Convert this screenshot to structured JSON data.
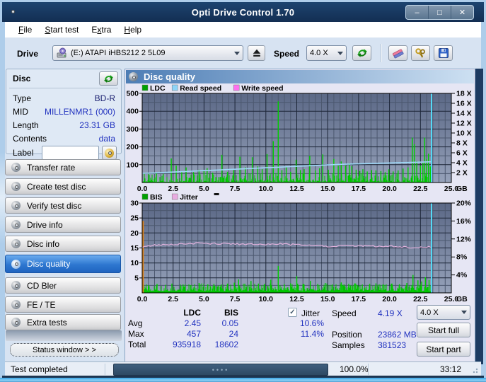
{
  "window": {
    "title": "Opti Drive Control 1.70",
    "controls": {
      "minimize": "–",
      "maximize": "□",
      "close": "✕"
    }
  },
  "menu": {
    "items": [
      {
        "pre": "",
        "u": "F",
        "rest": "ile"
      },
      {
        "pre": "",
        "u": "S",
        "rest": "tart test"
      },
      {
        "pre": "E",
        "u": "x",
        "rest": "tra"
      },
      {
        "pre": "",
        "u": "H",
        "rest": "elp"
      }
    ]
  },
  "drive_bar": {
    "drive_label": "Drive",
    "drive_value": "(E:)   ATAPI iHBS212   2 5L09",
    "speed_label": "Speed",
    "speed_value": "4.0 X"
  },
  "sidebar": {
    "disc_panel": {
      "title": "Disc",
      "rows": [
        {
          "label": "Type",
          "value": "BD-R"
        },
        {
          "label": "MID",
          "value": "MILLENMR1 (000)"
        },
        {
          "label": "Length",
          "value": "23.31 GB"
        },
        {
          "label": "Contents",
          "value": "data"
        }
      ],
      "label_row": {
        "label": "Label",
        "value": ""
      }
    },
    "buttons": [
      "Transfer rate",
      "Create test disc",
      "Verify test disc",
      "Drive info",
      "Disc info",
      "Disc quality",
      "CD Bler",
      "FE / TE",
      "Extra tests"
    ],
    "selected": "Disc quality",
    "status_window_button": "Status window > >"
  },
  "main": {
    "header": "Disc quality"
  },
  "chart_data": [
    {
      "name": "disc-quality-main-chart",
      "type": "bar",
      "legend": [
        "LDC",
        "Read speed",
        "Write speed"
      ],
      "legend_colors": [
        "#00a000",
        "#8ed4f8",
        "#ff70f0"
      ],
      "xlabel": "GB",
      "x_ticks": [
        "0.0",
        "2.5",
        "5.0",
        "7.5",
        "10.0",
        "12.5",
        "15.0",
        "17.5",
        "20.0",
        "22.5",
        "25.0"
      ],
      "xlim": [
        0,
        25
      ],
      "ylim_left": [
        0,
        500
      ],
      "y_ticks_left": [
        "500",
        "400",
        "300",
        "200",
        "100"
      ],
      "y_ticks_right": [
        "18 X",
        "16 X",
        "14 X",
        "12 X",
        "10 X",
        "8 X",
        "6 X",
        "4 X",
        "2 X"
      ],
      "data_end_gb": 23.35,
      "end_marker_gb": 23.4,
      "spikes": [
        [
          1.15,
          55
        ],
        [
          1.7,
          48
        ],
        [
          2.35,
          135
        ],
        [
          2.75,
          95
        ],
        [
          3.2,
          60
        ],
        [
          3.55,
          85
        ],
        [
          4.15,
          58
        ],
        [
          4.6,
          72
        ],
        [
          5.0,
          65
        ],
        [
          5.25,
          80
        ],
        [
          5.7,
          55
        ],
        [
          6.45,
          155
        ],
        [
          6.9,
          60
        ],
        [
          7.4,
          70
        ],
        [
          7.9,
          145
        ],
        [
          8.35,
          85
        ],
        [
          8.9,
          142
        ],
        [
          9.35,
          90
        ],
        [
          9.7,
          75
        ],
        [
          10.1,
          160
        ],
        [
          10.6,
          232
        ],
        [
          11.0,
          455
        ],
        [
          11.3,
          70
        ],
        [
          11.65,
          85
        ],
        [
          12.0,
          60
        ],
        [
          12.45,
          128
        ],
        [
          12.8,
          70
        ],
        [
          13.1,
          75
        ],
        [
          13.55,
          150
        ],
        [
          14.0,
          68
        ],
        [
          14.35,
          80
        ],
        [
          14.6,
          158
        ],
        [
          15.05,
          72
        ],
        [
          15.5,
          132
        ],
        [
          15.85,
          95
        ],
        [
          16.1,
          118
        ],
        [
          16.45,
          95
        ],
        [
          16.75,
          108
        ],
        [
          16.95,
          92
        ],
        [
          17.3,
          72
        ],
        [
          17.6,
          65
        ],
        [
          17.85,
          75
        ],
        [
          18.2,
          62
        ],
        [
          18.55,
          70
        ],
        [
          18.9,
          68
        ],
        [
          19.3,
          64
        ],
        [
          19.65,
          58
        ],
        [
          19.95,
          74
        ],
        [
          20.3,
          62
        ],
        [
          20.7,
          68
        ],
        [
          21.1,
          78
        ],
        [
          21.5,
          85
        ],
        [
          21.85,
          252
        ],
        [
          22.0,
          215
        ],
        [
          22.2,
          120
        ],
        [
          22.5,
          95
        ],
        [
          22.7,
          110
        ],
        [
          22.85,
          252
        ],
        [
          23.0,
          130
        ],
        [
          23.15,
          162
        ],
        [
          23.3,
          90
        ]
      ],
      "read_speed_x": [
        [
          0,
          1.85
        ],
        [
          1,
          1.95
        ],
        [
          2,
          2.06
        ],
        [
          3,
          2.17
        ],
        [
          4,
          2.29
        ],
        [
          5,
          2.4
        ],
        [
          6,
          2.52
        ],
        [
          7,
          2.63
        ],
        [
          8,
          2.75
        ],
        [
          9,
          2.86
        ],
        [
          10,
          2.98
        ],
        [
          11,
          3.09
        ],
        [
          12,
          3.21
        ],
        [
          13,
          3.33
        ],
        [
          14,
          3.44
        ],
        [
          15,
          3.56
        ],
        [
          16,
          3.67
        ],
        [
          17,
          3.74
        ],
        [
          18,
          3.81
        ],
        [
          19,
          3.88
        ],
        [
          20,
          3.95
        ],
        [
          21,
          4.02
        ],
        [
          22,
          4.09
        ],
        [
          23,
          4.15
        ],
        [
          23.4,
          4.19
        ]
      ]
    },
    {
      "name": "bis-jitter-chart",
      "type": "bar",
      "legend": [
        "BIS",
        "Jitter"
      ],
      "legend_colors": [
        "#00a000",
        "#e8ace0"
      ],
      "legend_artifact": true,
      "xlabel": "GB",
      "x_ticks": [
        "0.0",
        "2.5",
        "5.0",
        "7.5",
        "10.0",
        "12.5",
        "15.0",
        "17.5",
        "20.0",
        "22.5",
        "25.0"
      ],
      "xlim": [
        0,
        25
      ],
      "ylim_left": [
        0,
        30
      ],
      "y_ticks_left": [
        "30",
        "25",
        "20",
        "15",
        "10",
        "5"
      ],
      "y_ticks_right": [
        "20%",
        "16%",
        "12%",
        "8%",
        "4%"
      ],
      "data_end_gb": 23.35,
      "end_marker_gb": 23.4,
      "start_marker": {
        "gb": 0.07,
        "value": 24,
        "color": "#e08418"
      },
      "spikes": [
        [
          0.5,
          2.6
        ],
        [
          1.2,
          3.0
        ],
        [
          1.9,
          2.7
        ],
        [
          2.4,
          3.1
        ],
        [
          3.3,
          2.8
        ],
        [
          3.9,
          2.6
        ],
        [
          4.6,
          3.3
        ],
        [
          5.3,
          2.8
        ],
        [
          5.8,
          3.0
        ],
        [
          6.4,
          2.7
        ],
        [
          6.9,
          3.1
        ],
        [
          7.45,
          3.4
        ],
        [
          7.8,
          4.5
        ],
        [
          8.3,
          3.0
        ],
        [
          8.8,
          4.0
        ],
        [
          9.4,
          3.1
        ],
        [
          9.9,
          2.9
        ],
        [
          10.4,
          4.4
        ],
        [
          11.0,
          9.0
        ],
        [
          11.5,
          2.9
        ],
        [
          12.0,
          3.2
        ],
        [
          12.5,
          5.6
        ],
        [
          13.0,
          2.9
        ],
        [
          13.6,
          4.0
        ],
        [
          14.2,
          3.0
        ],
        [
          14.8,
          3.3
        ],
        [
          15.4,
          2.8
        ],
        [
          16.1,
          3.5
        ],
        [
          16.7,
          3.0
        ],
        [
          17.2,
          3.2
        ],
        [
          17.8,
          2.8
        ],
        [
          18.4,
          3.0
        ],
        [
          18.9,
          3.2
        ],
        [
          19.5,
          2.8
        ],
        [
          20.2,
          3.1
        ],
        [
          20.8,
          2.9
        ],
        [
          21.4,
          3.3
        ],
        [
          21.9,
          6.0
        ],
        [
          22.3,
          4.2
        ],
        [
          22.6,
          3.8
        ],
        [
          22.9,
          5.2
        ],
        [
          23.2,
          4.3
        ]
      ],
      "jitter_line_pct": [
        [
          0,
          10.1
        ],
        [
          0.5,
          10.4
        ],
        [
          1,
          10.6
        ],
        [
          2,
          10.75
        ],
        [
          3,
          10.85
        ],
        [
          4,
          11.0
        ],
        [
          5,
          11.05
        ],
        [
          6,
          10.95
        ],
        [
          7,
          10.95
        ],
        [
          8,
          10.85
        ],
        [
          9,
          10.85
        ],
        [
          10,
          10.8
        ],
        [
          11,
          10.95
        ],
        [
          12,
          10.75
        ],
        [
          13,
          10.75
        ],
        [
          14,
          10.65
        ],
        [
          15,
          10.35
        ],
        [
          16,
          10.45
        ],
        [
          17,
          10.55
        ],
        [
          18,
          10.45
        ],
        [
          19,
          10.35
        ],
        [
          20,
          10.45
        ],
        [
          21,
          10.2
        ],
        [
          22,
          10.1
        ],
        [
          23,
          10.2
        ],
        [
          23.4,
          10.2
        ]
      ]
    }
  ],
  "results": {
    "col_headers": [
      "LDC",
      "BIS"
    ],
    "rows": [
      {
        "label": "Avg",
        "ldc": "2.45",
        "bis": "0.05",
        "jitter_pct": "10.6%"
      },
      {
        "label": "Max",
        "ldc": "457",
        "bis": "24",
        "jitter_pct": "11.4%"
      },
      {
        "label": "Total",
        "ldc": "935918",
        "bis": "18602",
        "jitter_pct": ""
      }
    ],
    "jitter_checkbox_label": "Jitter",
    "jitter_checked": true,
    "speed_label": "Speed",
    "speed_value": "4.19 X",
    "position_label": "Position",
    "position_value": "23862 MB",
    "samples_label": "Samples",
    "samples_value": "381523",
    "speed_select": "4.0 X",
    "start_full": "Start full",
    "start_part": "Start part"
  },
  "status_bar": {
    "status_text": "Test completed",
    "progress_percent": "100.0%",
    "elapsed": "33:12"
  },
  "colors": {
    "accent_selected": "#2e77d0",
    "value_text": "#2233bf",
    "ldc_green": "#00c400",
    "read_speed_blue": "#9fd9f8",
    "jitter_pink": "#e2b2dd",
    "end_marker_cyan": "#55d9f6",
    "start_marker_orange": "#e08418",
    "titlebar_navy": "#16355c"
  }
}
